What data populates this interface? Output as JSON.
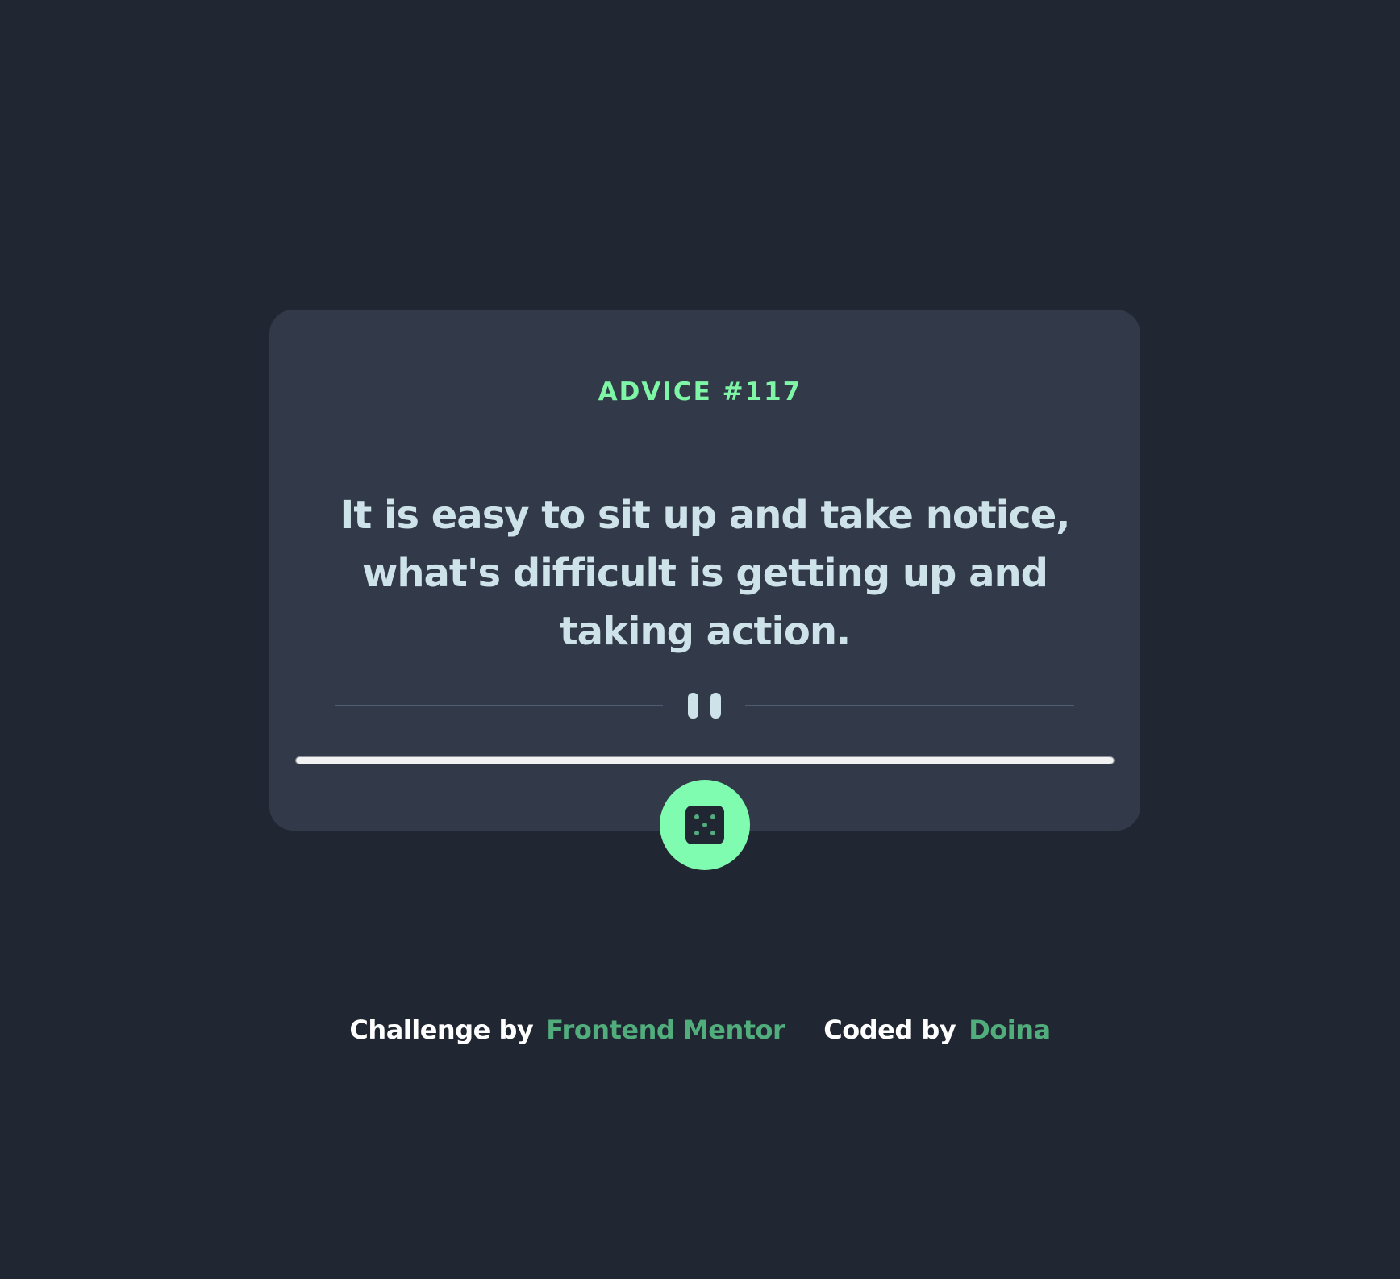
{
  "advice": {
    "label": "ADVICE #117",
    "quote": "It is easy to sit up and take notice, what's difficult is getting up and taking action."
  },
  "icons": {
    "divider": "pause-icon",
    "button": "dice-icon"
  },
  "progress": {
    "fraction": 1.0
  },
  "footer": {
    "challenge_prefix": "Challenge by",
    "challenge_link": "Frontend Mentor",
    "coded_prefix": "Coded by",
    "coded_link": "Doina"
  },
  "colors": {
    "background": "#202632",
    "card": "#323a49",
    "accent": "#7ffcb0",
    "text": "#cee3e9",
    "link": "#52ad7d"
  }
}
